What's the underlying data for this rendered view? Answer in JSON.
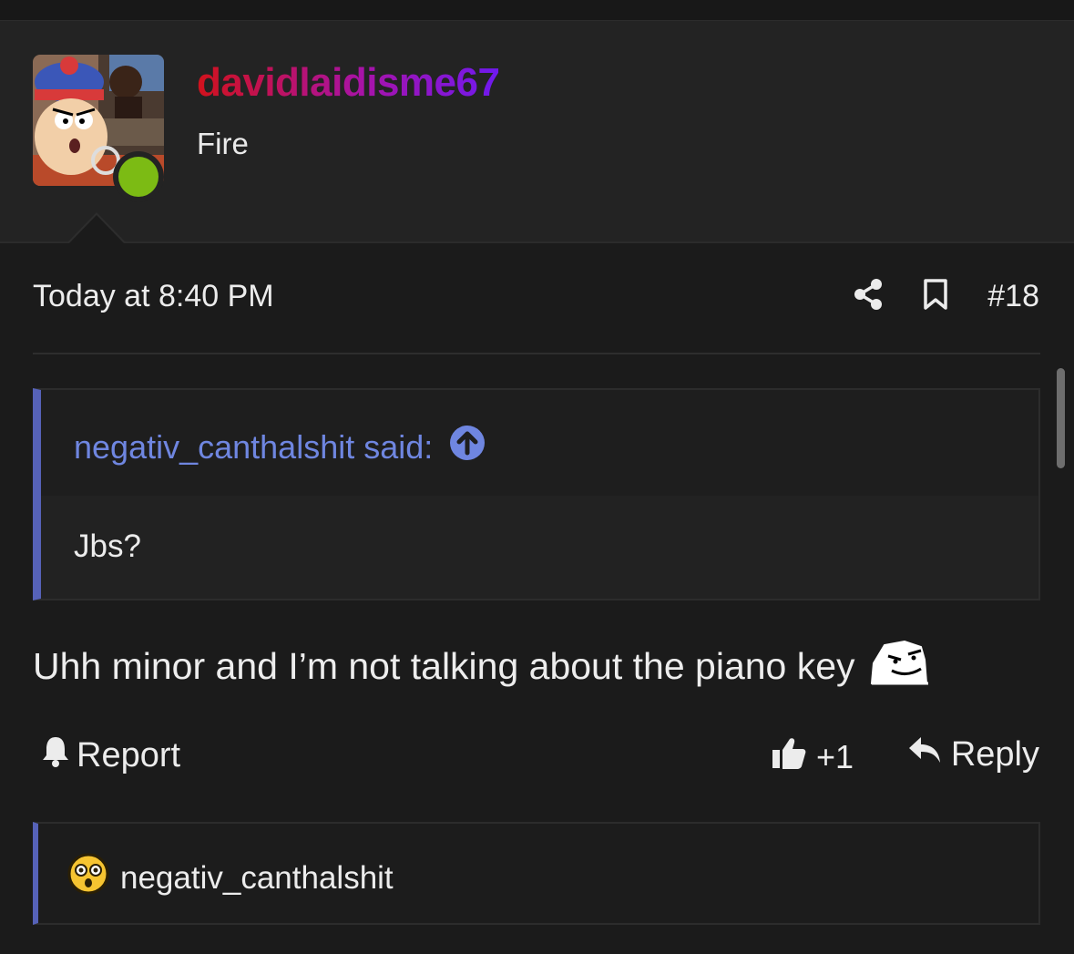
{
  "colors": {
    "accent": "#5662b8",
    "quote_author": "#6f86e0",
    "online": "#7cbb14",
    "username_gradient": [
      "#d1121c",
      "#a813a8",
      "#6f19f0"
    ]
  },
  "post": {
    "username": "davidlaidisme67",
    "user_title": "Fire",
    "avatar_icon": "avatar-image",
    "online_status": "online",
    "date": "Today at 8:40 PM",
    "post_number": "#18",
    "share_icon": "share-icon",
    "bookmark_icon": "bookmark-icon"
  },
  "quote": {
    "author": "negativ_canthalshit said:",
    "jump_icon": "arrow-up-circle-icon",
    "body": "Jbs?"
  },
  "message": {
    "text": "Uhh minor and I’m not talking about the piano key",
    "emoji_icon": "meme-face-icon"
  },
  "actions": {
    "report_label": "Report",
    "report_icon": "bell-icon",
    "like_label": "+1",
    "like_icon": "thumbs-up-icon",
    "reply_label": "Reply",
    "reply_icon": "reply-arrow-icon"
  },
  "reactions": {
    "emoji_icon": "flushed-face-icon",
    "users": "negativ_canthalshit"
  }
}
